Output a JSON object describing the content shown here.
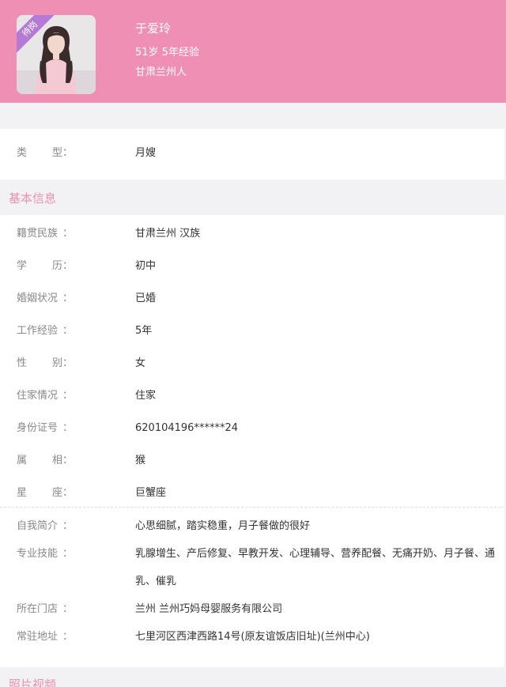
{
  "header": {
    "badge": "待岗",
    "name": "于爱玲",
    "age_exp": "51岁 5年经验",
    "origin": "甘肃兰州人"
  },
  "type_row": {
    "label": "类　型",
    "value": "月嫂"
  },
  "basic": {
    "title": "基本信息",
    "rows": [
      {
        "label": "籍贯民族",
        "value": "甘肃兰州 汉族"
      },
      {
        "label": "学　历",
        "value": "初中"
      },
      {
        "label": "婚姻状况",
        "value": "已婚"
      },
      {
        "label": "工作经验",
        "value": "5年"
      },
      {
        "label": "性　别",
        "value": "女"
      },
      {
        "label": "住家情况",
        "value": "住家"
      },
      {
        "label": "身份证号",
        "value": "620104196******24"
      },
      {
        "label": "属　相",
        "value": "猴"
      },
      {
        "label": "星　座",
        "value": "巨蟹座"
      }
    ]
  },
  "details": {
    "rows": [
      {
        "label": "自我简介",
        "value": "心思细腻，踏实稳重，月子餐做的很好"
      },
      {
        "label": "专业技能",
        "value": "乳腺增生、产后修复、早教开发、心理辅导、营养配餐、无痛开奶、月子餐、通乳、催乳"
      },
      {
        "label": "所在门店",
        "value": "兰州 兰州巧妈母婴服务有限公司"
      },
      {
        "label": "常驻地址",
        "value": "七里河区西津西路14号(原友谊饭店旧址)(兰州中心)"
      }
    ]
  },
  "photos": {
    "title": "照片视频"
  },
  "colon": "：",
  "colors": {
    "accent": "#ef8fb3",
    "badge": "#b57ad6"
  }
}
